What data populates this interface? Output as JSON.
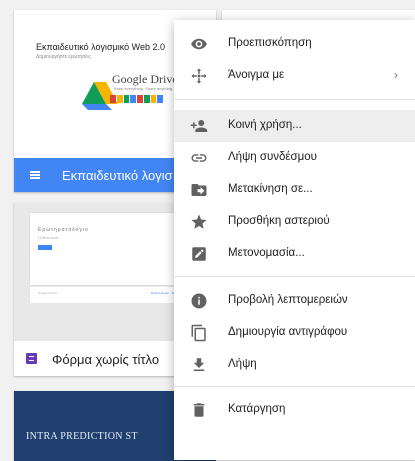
{
  "files": {
    "slides": {
      "title": "Εκπαιδευτικό λογισμικό Web 2.0",
      "subtitle": "Δημιουργήστε ερωτήσεις",
      "logo_text": "Google Drive",
      "logo_tag": "Keep everything. Share anything.",
      "name": "Εκπαιδευτικό λογισ"
    },
    "form": {
      "title_line": "Ερωτηματολόγιο",
      "desc_line": "Η ιδέα είναι ...",
      "footer_left": "Google Forms",
      "footer_right": "Report Abuse · Terms of Service",
      "name": "Φόρμα χωρίς τίτλο"
    },
    "doc": {
      "title": "INTRA PREDICTION ST"
    }
  },
  "menu": {
    "items": [
      {
        "label": "Προεπισκόπηση",
        "icon": "eye-icon"
      },
      {
        "label": "Άνοιγμα με",
        "icon": "move-arrows-icon",
        "submenu": "›"
      },
      {
        "label": "Κοινή χρήση...",
        "icon": "add-person-icon"
      },
      {
        "label": "Λήψη συνδέσμου",
        "icon": "link-icon"
      },
      {
        "label": "Μετακίνηση σε...",
        "icon": "folder-move-icon"
      },
      {
        "label": "Προσθήκη αστεριού",
        "icon": "star-icon"
      },
      {
        "label": "Μετονομασία...",
        "icon": "edit-icon"
      },
      {
        "label": "Προβολή λεπτομερειών",
        "icon": "info-icon"
      },
      {
        "label": "Δημιουργία αντιγράφου",
        "icon": "copy-icon"
      },
      {
        "label": "Λήψη",
        "icon": "download-icon"
      },
      {
        "label": "Κατάργηση",
        "icon": "trash-icon"
      }
    ]
  },
  "colors": {
    "slides_bar": "#4285f4",
    "forms_icon": "#673ab7",
    "menu_icon": "#616161",
    "hover": "#eeeeee"
  }
}
